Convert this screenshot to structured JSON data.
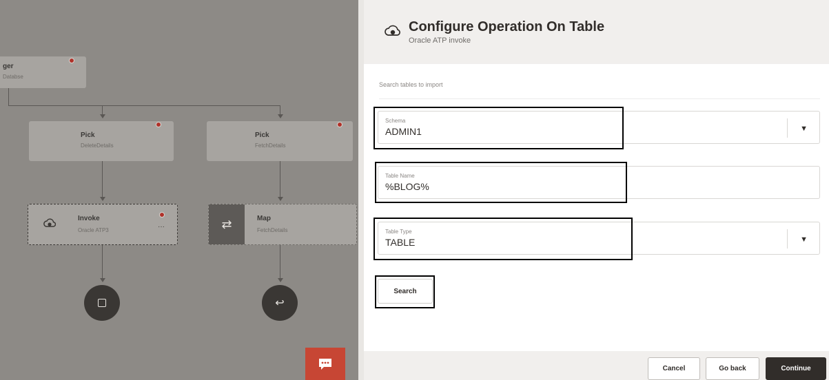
{
  "canvas": {
    "nodes": [
      {
        "title": "ger",
        "sub": "Databse"
      },
      {
        "title": "Pick",
        "sub": "DeleteDetails"
      },
      {
        "title": "Pick",
        "sub": "FetchDetails"
      },
      {
        "title": "Invoke",
        "sub": "Oracle ATP3",
        "more": "···"
      },
      {
        "title": "Map",
        "sub": "FetchDetails"
      }
    ]
  },
  "panel": {
    "title": "Configure Operation On Table",
    "subtitle": "Oracle ATP invoke",
    "search_tables_label": "Search tables to import",
    "fields": {
      "schema": {
        "label": "Schema",
        "value": "ADMIN1"
      },
      "table_name": {
        "label": "Table Name",
        "value": "%BLOG%"
      },
      "table_type": {
        "label": "Table Type",
        "value": "TABLE"
      }
    },
    "search_button": "Search",
    "footer": {
      "cancel": "Cancel",
      "go_back": "Go back",
      "continue": "Continue"
    }
  }
}
